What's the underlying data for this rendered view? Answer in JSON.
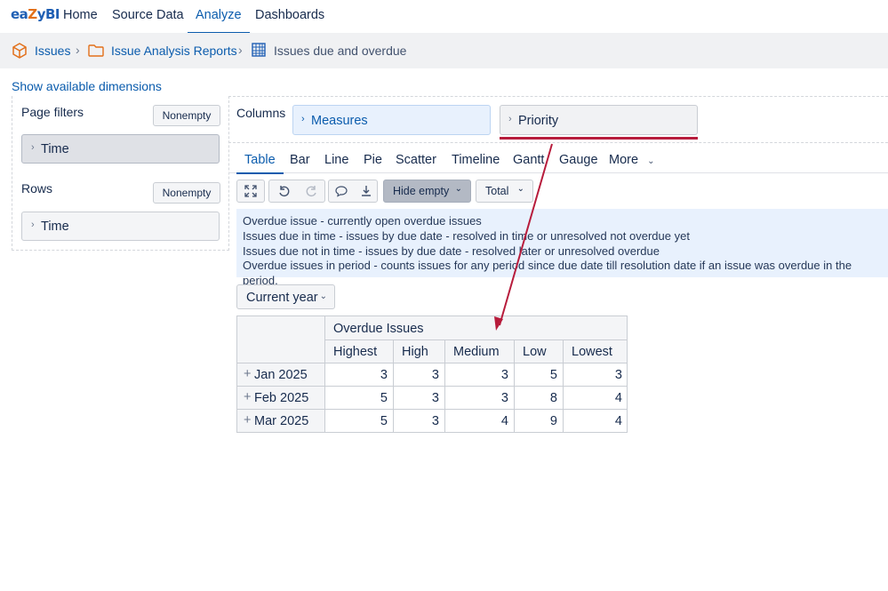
{
  "app": {
    "logo_text": "eazyBI",
    "nav": [
      "Home",
      "Source Data",
      "Analyze",
      "Dashboards"
    ],
    "active_nav": "Analyze"
  },
  "breadcrumb": {
    "items": [
      "Issues",
      "Issue Analysis Reports",
      "Issues due and overdue"
    ]
  },
  "show_dimensions": "Show available dimensions",
  "left_panel": {
    "page_filters_label": "Page filters",
    "nonempty_label": "Nonempty",
    "page_filter_dim": "Time",
    "rows_label": "Rows",
    "rows_nonempty_label": "Nonempty",
    "rows_dim": "Time"
  },
  "columns": {
    "label": "Columns",
    "dims": [
      "Measures",
      "Priority"
    ]
  },
  "view_tabs": [
    "Table",
    "Bar",
    "Line",
    "Pie",
    "Scatter",
    "Timeline",
    "Gantt",
    "Gauge",
    "More"
  ],
  "active_tab": "Table",
  "toolbar": {
    "hide_empty": "Hide empty",
    "total": "Total",
    "icons": [
      "fullscreen-icon",
      "undo-icon",
      "redo-icon",
      "comment-icon",
      "download-icon"
    ]
  },
  "info_lines": [
    "Overdue issue - currently open overdue issues",
    "Issues due in time - issues by due date - resolved in time or unresolved not overdue yet",
    "Issues due not in time - issues by due date - resolved later or unresolved overdue",
    "Overdue issues in period - counts issues for any period since due date till resolution date if an issue was overdue in the period."
  ],
  "year_select": "Current year",
  "table": {
    "measure": "Overdue Issues",
    "columns": [
      "Highest",
      "High",
      "Medium",
      "Low",
      "Lowest"
    ],
    "rows": [
      {
        "label": "Jan 2025",
        "values": [
          "3",
          "3",
          "3",
          "5",
          "3"
        ]
      },
      {
        "label": "Feb 2025",
        "values": [
          "5",
          "3",
          "3",
          "8",
          "4"
        ]
      },
      {
        "label": "Mar 2025",
        "values": [
          "5",
          "3",
          "4",
          "9",
          "4"
        ]
      }
    ]
  },
  "colors": {
    "link": "#0b5cad",
    "annotation_red": "#b71c3c",
    "info_bg": "#e8f1fd",
    "breadcrumb_bg": "#f0f1f3"
  }
}
